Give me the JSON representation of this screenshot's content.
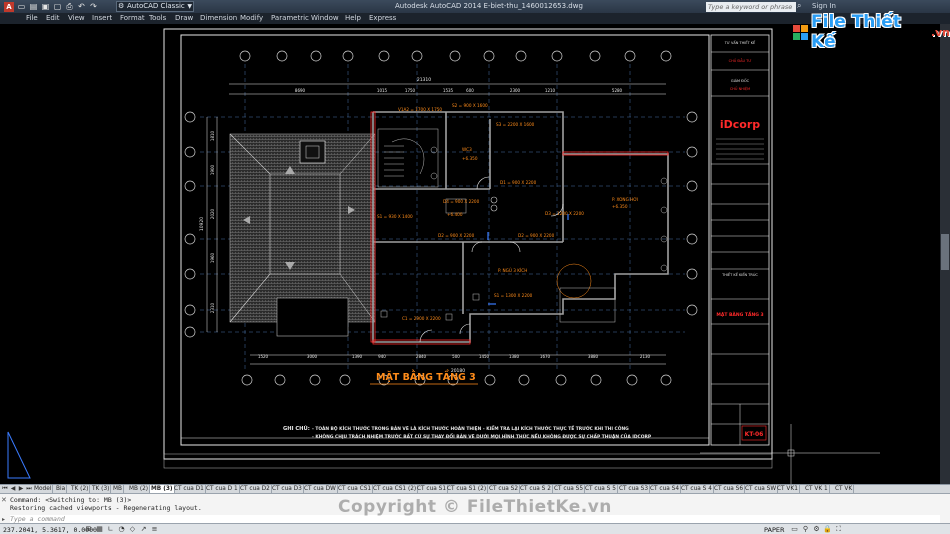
{
  "colors": {
    "accent_orange": "#ff8c1a",
    "cad_red": "#ff2a2a",
    "cad_cyan": "#00e5ff",
    "cad_white": "#f0f0f0",
    "wall_gray": "#a0a0a0",
    "watermark_blue": "#2a9df4"
  },
  "titlebar": {
    "workspace": "AutoCAD Classic",
    "title": "Autodesk AutoCAD 2014   E-biet-thu_1460012653.dwg",
    "search_placeholder": "Type a keyword or phrase",
    "signin": "Sign In"
  },
  "menu": [
    "File",
    "Edit",
    "View",
    "Insert",
    "Format",
    "Tools",
    "Draw",
    "Dimension",
    "Modify",
    "Parametric",
    "Window",
    "Help",
    "Express"
  ],
  "drawing": {
    "plan_title": "MẶT BẰNG TẦNG 3",
    "note_label": "GHI CHÚ:",
    "note_1": "- TOÀN BỘ KÍCH THƯỚC TRONG BẢN VẼ LÀ KÍCH THƯỚC HOÀN THIỆN - KIỂM TRA LẠI KÍCH THƯỚC THỰC TẾ TRƯỚC KHI THI CÔNG",
    "note_2": "- KHÔNG CHỊU TRÁCH NHIỆM TRƯỚC BẤT CỨ SỰ THAY ĐỔI BẢN VẼ DƯỚI MỌI HÌNH THỨC NẾU KHÔNG ĐƯỢC SỰ CHẤP THUẬN CỦA IDCORP",
    "top_total_dim": "21310",
    "top_dims": [
      "8690",
      "1015",
      "1750",
      "1535",
      "600",
      "2300",
      "1210",
      "5280"
    ],
    "bottom_total_dim": "20180",
    "bottom_dims": [
      "1520",
      "3000",
      "1390",
      "940",
      "2840",
      "500",
      "1450",
      "1380",
      "1670",
      "3880",
      "2130"
    ],
    "left_total_dim": "10920",
    "left_dims": [
      "1810",
      "1900",
      "2020",
      "1960",
      "2310"
    ],
    "room_labels": {
      "wc": "WC3",
      "wc_level": "+6.350",
      "balcony": "P. XONG HƠI",
      "balcony_level": "+6.350",
      "bedroom": "P. NGỦ 3 KÍCH",
      "level_main": "+6.400"
    },
    "door_labels": [
      "V1A2 = 1700 X 1750",
      "S2 = 900 X 1600",
      "S3 = 2200 X 1600",
      "D1 = 900 X 2200",
      "D4 = 900 X 2200",
      "S1 = 930 X 1400",
      "D3 = 1200 X 2200",
      "D2 = 900 X 2200",
      "D2 = 900 X 2200",
      "S1 = 1300 X 2200",
      "C1 = 2900 X 2200"
    ],
    "titleblock": {
      "brand": "iDcorp",
      "box_label": "KT-06",
      "sheet_name": "MẶT BẰNG TẦNG 3",
      "line_a": "TƯ VẤN THIẾT KẾ",
      "line_b": "CHỦ ĐẦU TƯ",
      "line_c": "GIÁM ĐỐC",
      "line_d": "CHỦ NHIỆM",
      "line_e": "THIẾT KẾ KIẾN TRÚC"
    }
  },
  "tabs": [
    "Model",
    "Bia",
    "TK (2)",
    "TK (3)",
    "MB",
    "MB (2)",
    "MB (3)",
    "CT cua D1",
    "CT cua D 1",
    "CT cua D2",
    "CT cua D3",
    "CT cua DW",
    "CT cua CS1",
    "CT cua CS1 (2)",
    "CT cua S1",
    "CT cua S1 (2)",
    "CT cua S2",
    "CT cua S 2",
    "CT cua S5",
    "CT cua S 5",
    "CT cua S3",
    "CT cua S4",
    "CT cua S 4",
    "CT cua S6",
    "CT cua SW",
    "CT VK1",
    "CT VK 1",
    "CT VK"
  ],
  "active_tab": "MB (3)",
  "command": {
    "line1": "Command:   <Switching to: MB (3)>",
    "line2": "Restoring cached viewports - Regenerating layout.",
    "prompt": "Type a command"
  },
  "status": {
    "coords": "237.2041, 5.3617, 0.0000",
    "space": "PAPER"
  },
  "watermark": {
    "text": "Copyright © FileThietKe.vn",
    "logo_name": "File Thiết Kế",
    "logo_tld": ".vn"
  }
}
